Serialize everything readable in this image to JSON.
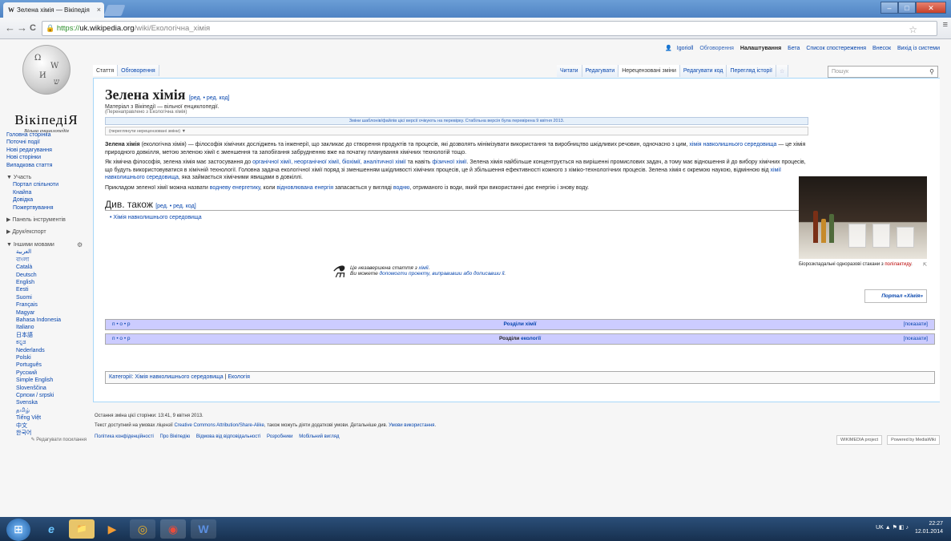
{
  "browser": {
    "tab_title": "Зелена хімія — Вікіпедія",
    "tab_logo": "W",
    "tab_close": "×",
    "url_lock": "🔒",
    "url_https": "https://",
    "url_host": "uk.wikipedia.org",
    "url_path": "/wiki/Екологічна_хімія",
    "back": "←",
    "forward": "→",
    "reload": "C",
    "star": "☆",
    "menu": "≡",
    "win_min": "–",
    "win_max": "□",
    "win_close": "✕"
  },
  "logo": {
    "wordmark": "ВікіпедіЯ",
    "tagline": "Вільна енциклопедія"
  },
  "personal": {
    "user": "Igorioll",
    "talk": "Обговорення",
    "prefs": "Налаштування",
    "beta": "Бета",
    "watchlist": "Список спостереження",
    "contribs": "Внесок",
    "logout": "Вихід із системи"
  },
  "tabs": {
    "article": "Стаття",
    "talk": "Обговорення",
    "read": "Читати",
    "edit": "Редагувати",
    "unreviewed": "Нерецензовані зміни",
    "editsource": "Редагувати код",
    "history": "Перегляд історії",
    "star": "☆",
    "search_placeholder": "Пошук",
    "search_icon": "⚲"
  },
  "sidebar": {
    "nav": [
      "Головна сторінка",
      "Поточні події",
      "Нові редагування",
      "Нові сторінки",
      "Випадкова стаття"
    ],
    "participation_header": "▼ Участь",
    "participation": [
      "Портал спільноти",
      "Кнайпа",
      "Довідка",
      "Пожертвування"
    ],
    "print_header": "▶ Панель інструментів",
    "tools_header": "▶ Друк/експорт",
    "langs_header": "▼ Іншими мовами",
    "langs_gear": "⚙",
    "langs": [
      "العربية",
      "বাংলা",
      "Català",
      "Deutsch",
      "English",
      "Eesti",
      "Suomi",
      "Français",
      "Magyar",
      "Bahasa Indonesia",
      "Italiano",
      "日本語",
      "ಕನ್ನಡ",
      "Nederlands",
      "Polski",
      "Português",
      "Русский",
      "Simple English",
      "Slovenščina",
      "Српски / srpski",
      "Svenska",
      "தமிழ்",
      "Tiếng Việt",
      "中文",
      "한국어"
    ],
    "edit_links": "✎ Редагувати посилання"
  },
  "article": {
    "title": "Зелена хімія",
    "title_edit": "[ред. • ред. код]",
    "site_sub": "Матеріал з Вікіпедії — вільної енциклопедії.",
    "redirect": "(Перенаправлено з Екологічна хімія)",
    "flagged": "Зміни шаблонів/файлів цієї версії очікують на перевірку. Стабільна версія була перевірена 9 квітня 2013.",
    "review": "(переглянути нерецензовані зміни) ▼",
    "p1_a": "Зелена хімія",
    "p1_b": " (екологічна хімія) — філософія хімічних досліджень та інженерії, що закликає до створення продуктів та процесів, які дозволять мінімізувати використання та виробництво шкідливих речовин, одночасно з цим, ",
    "p1_c": "хімія навколишнього середовища",
    "p1_d": " — це хімія природного довкілля, метою зеленою хімії є зменшення та запобігання забрудненню вже на початку планування хімічних технологій тощо.",
    "p2_a": "Як хімічна філософія, зелена хімія має застосування до ",
    "p2_b": "органічної хімії, неорганічної хімії, біохімії, аналітичної хімії",
    "p2_c": " та навіть ",
    "p2_d": "фізичної хімії",
    "p2_e": ". Зелена хімія найбільше концентрується на вирішенні промислових задач, а тому має відношення й до вибору хімічних процесів, що будуть використовуватися в хімічній технології. Головна задача екологічної хімії поряд зі зменшенням шкідливості хімічних процесів, це й збільшення ефективності кожного з хіміко-технологічних процесів. Зелена хімія є окремою наукою, відмінною від ",
    "p2_f": "хімії навколишнього середовища",
    "p2_g": ", яка займається хімічними явищами в довкіллі.",
    "p3_a": "Прикладом зеленої хімії можна назвати ",
    "p3_b": "водневу енергетику",
    "p3_c": ", коли ",
    "p3_d": "відновлювана енергія",
    "p3_e": " запасається у вигляді ",
    "p3_f": "водню",
    "p3_g": ", отриманого із води, який при використанні дає енергію і знову воду.",
    "h2": "Див. також",
    "h2_edit": "[ред. • ред. код]",
    "see_also": "• Хімія навколишнього середовища",
    "stub_line1_a": "Це незавершена стаття з ",
    "stub_line1_b": "хімії",
    "stub_line1_c": ".",
    "stub_line2_a": "Ви можете ",
    "stub_line2_b": "допомогти проекту, виправивши або дописавши її",
    "stub_line2_c": ".",
    "stub_icon": "⚗",
    "thumb_caption_a": "Біорозкладальні одноразові стакани з ",
    "thumb_caption_b": "полілактиду",
    "thumb_caption_c": ".",
    "thumb_enlarge": "⇱",
    "portal": "Портал «Хімія»",
    "navbox1": "Розділи хімії",
    "navbox2_a": "Розділи ",
    "navbox2_b": "екології",
    "vte": "п • о • р",
    "show": "[показати]",
    "categories_label": "Категорії:",
    "cat1": "Хімія навколишнього середовища",
    "cat2": "Екологія"
  },
  "footer": {
    "lastmod": "Остання зміна цієї сторінки: 13:41, 9 квітня 2013.",
    "license_a": "Текст доступний на умовах ліцензії ",
    "license_b": "Creative Commons Attribution/Share-Alike",
    "license_c": ", також можуть діяти додаткові умови. Детальніше див. ",
    "license_d": "Умови використання",
    "license_e": ".",
    "links": [
      "Політика конфіденційності",
      "Про Вікіпедію",
      "Відмова від відповідальності",
      "Розробники",
      "Мобільний вигляд"
    ],
    "badge1": "WIKIMEDIA project",
    "badge2": "Powered by MediaWiki"
  },
  "taskbar": {
    "start": "⊞",
    "icons": [
      "e",
      "📁",
      "▶",
      "◎",
      "◉",
      "W"
    ],
    "tray_symbols": "UK ▲ ⚑ ◧ ♪",
    "time": "22:27",
    "date": "12.01.2014"
  }
}
